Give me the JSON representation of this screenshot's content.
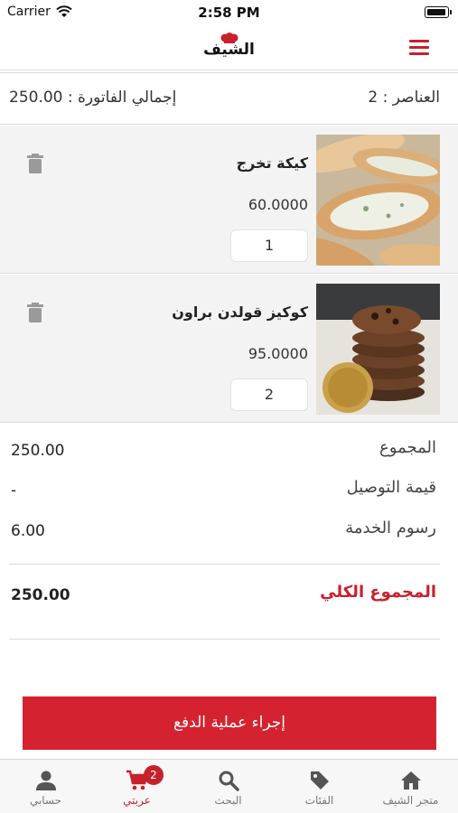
{
  "status_bar": {
    "carrier": "Carrier",
    "time": "2:58 PM"
  },
  "header": {
    "logo_text": "الشيف"
  },
  "summary": {
    "items_count": "العناصر : 2",
    "invoice_total": "إجمالي الفاتورة : 250.00"
  },
  "cart": {
    "items": [
      {
        "name": "كيكة تخرج",
        "price": "60.0000",
        "quantity": "1"
      },
      {
        "name": "كوكيز قولدن براون",
        "price": "95.0000",
        "quantity": "2"
      }
    ]
  },
  "totals": {
    "subtotal_label": "المجموع",
    "subtotal_value": "250.00",
    "delivery_label": "قيمة التوصيل",
    "delivery_value": "-",
    "service_label": "رسوم الخدمة",
    "service_value": "6.00",
    "grand_label": "المجموع الكلي",
    "grand_value": "250.00"
  },
  "checkout": {
    "label": "إجراء عملية الدفع"
  },
  "tab_bar": {
    "tabs": [
      {
        "label": "متجر الشيف",
        "icon": "home-icon"
      },
      {
        "label": "الفئات",
        "icon": "tag-icon"
      },
      {
        "label": "البحث",
        "icon": "search-icon"
      },
      {
        "label": "عربتي",
        "icon": "cart-icon",
        "badge": "2"
      },
      {
        "label": "حسابي",
        "icon": "person-icon"
      }
    ]
  },
  "colors": {
    "accent": "#c8202d",
    "button": "#d52230"
  }
}
